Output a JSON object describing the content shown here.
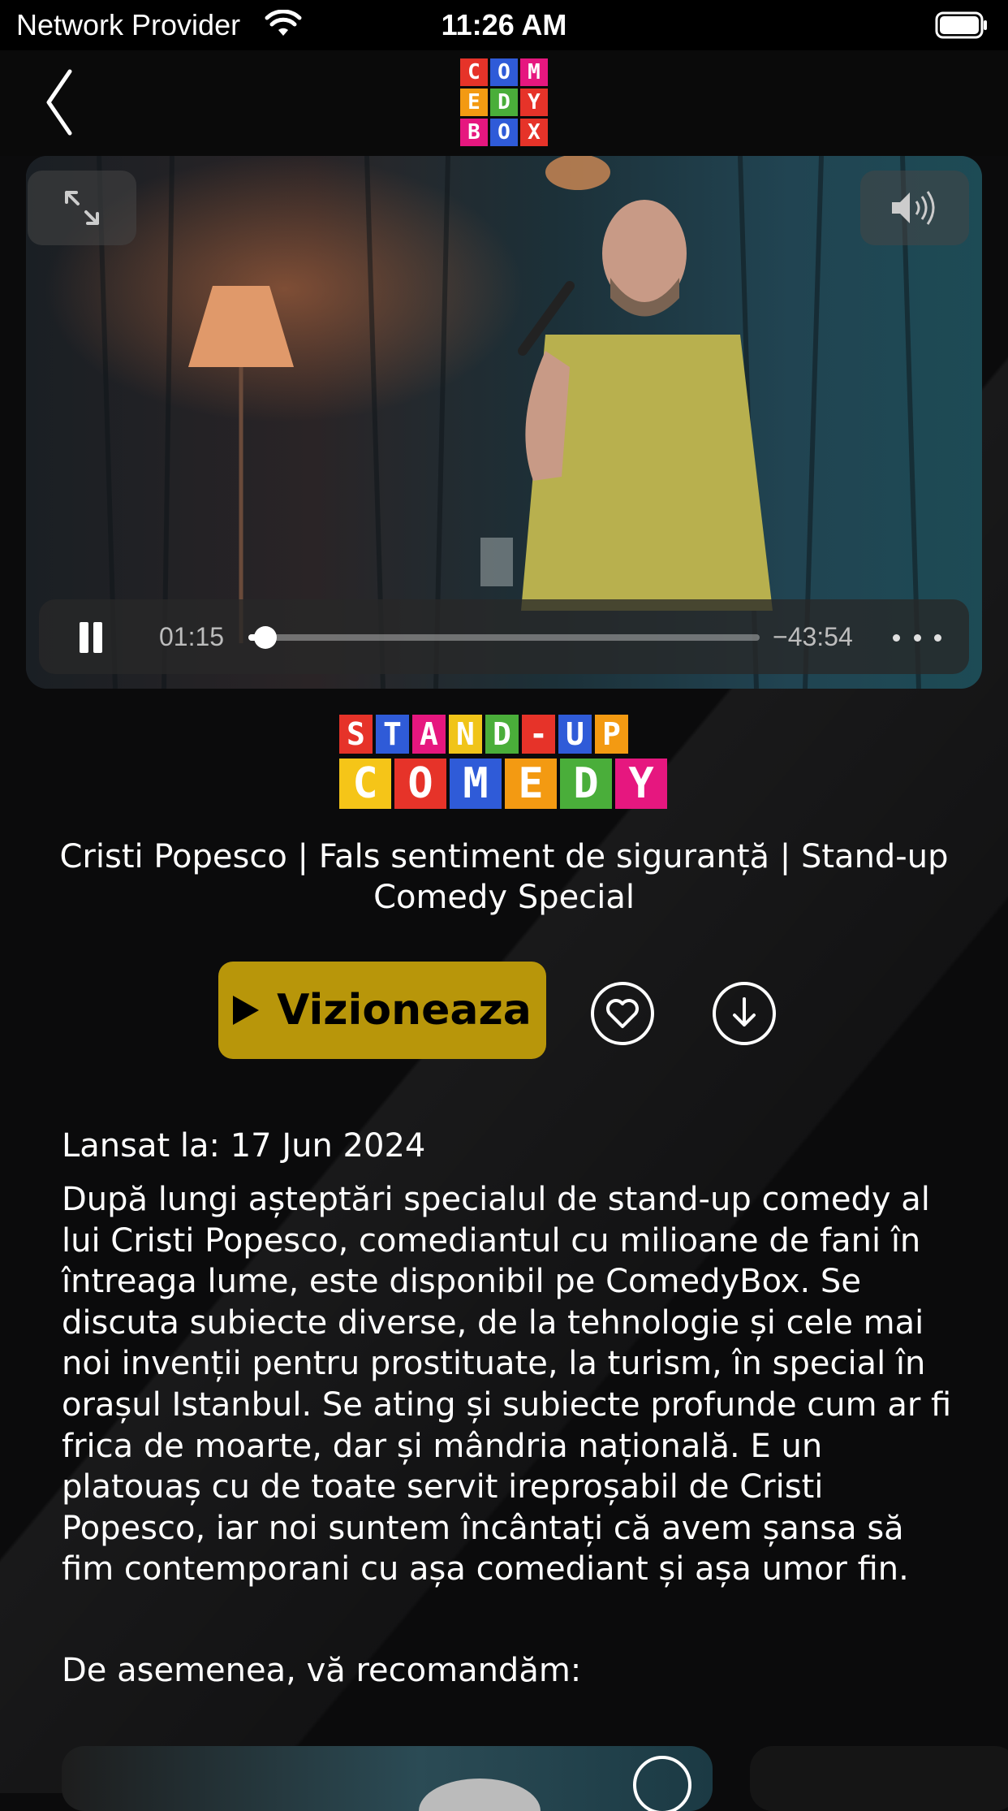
{
  "status_bar": {
    "provider": "Network Provider",
    "time": "11:26 AM"
  },
  "nav": {
    "logo_letters": [
      "C",
      "O",
      "M",
      "E",
      "D",
      "Y",
      "B",
      "O",
      "X"
    ],
    "logo_colors": [
      "#e63329",
      "#2f5bd8",
      "#e6177f",
      "#f39a12",
      "#4aae3a",
      "#e63329",
      "#e6177f",
      "#2f5bd8",
      "#e63329"
    ]
  },
  "player": {
    "elapsed": "01:15",
    "remaining": "−43:54",
    "progress": 0.034
  },
  "show_logo": {
    "row1": [
      "S",
      "T",
      "A",
      "N",
      "D",
      "-",
      "U",
      "P"
    ],
    "row1_colors": [
      "#e63329",
      "#2f5bd8",
      "#e6177f",
      "#f0c419",
      "#4aae3a",
      "#e63329",
      "#2f5bd8",
      "#f39a12"
    ],
    "row2": [
      "C",
      "O",
      "M",
      "E",
      "D",
      "Y"
    ],
    "row2_colors": [
      "#f5c518",
      "#e63329",
      "#2f5bd8",
      "#f39a12",
      "#4aae3a",
      "#e6177f"
    ]
  },
  "title": "Cristi Popesco | Fals sentiment de siguranță | Stand-up Comedy Special",
  "actions": {
    "watch_label": "Vizioneaza"
  },
  "released": "Lansat la: 17 Jun 2024",
  "description": "După lungi așteptări specialul de stand-up comedy al lui Cristi Popesco, comediantul cu milioane de fani în întreaga lume, este disponibil pe ComedyBox. Se discuta subiecte diverse, de la tehnologie și cele mai noi invenții pentru prostituate, la turism, în special în orașul Istanbul. Se ating și subiecte profunde cum ar fi frica de moarte, dar și mândria națională. E un platouaș cu de toate servit ireproșabil de Cristi Popesco, iar noi suntem încântați că avem șansa să fim contemporani cu așa comediant și așa umor fin.",
  "recommend_title": "De asemenea, vă recomandăm:"
}
